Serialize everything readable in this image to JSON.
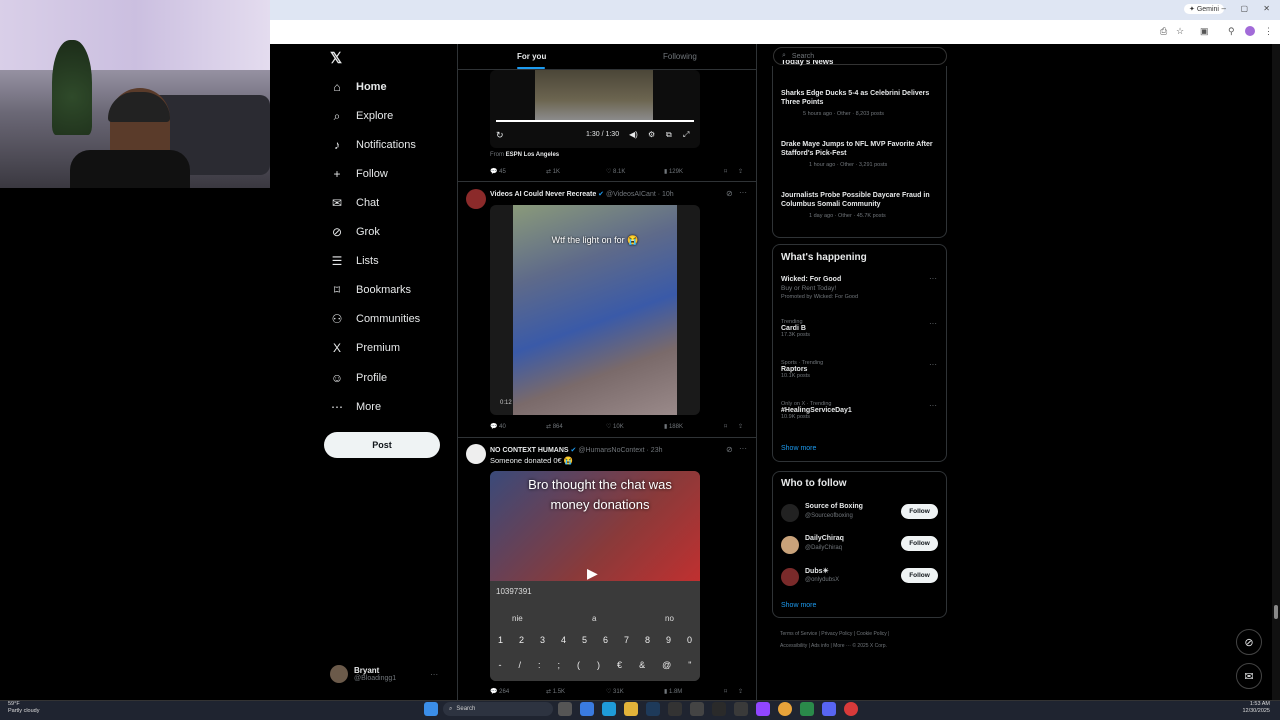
{
  "browser": {
    "gemini_label": "Gemini",
    "window_controls": [
      "–",
      "▢",
      "✕"
    ]
  },
  "nav": {
    "items": [
      {
        "label": "Home",
        "icon": "⌂",
        "icon_name": "home-icon"
      },
      {
        "label": "Explore",
        "icon": "⌕",
        "icon_name": "search-icon"
      },
      {
        "label": "Notifications",
        "icon": "♪",
        "icon_name": "bell-icon"
      },
      {
        "label": "Follow",
        "icon": "+",
        "icon_name": "add-person-icon"
      },
      {
        "label": "Chat",
        "icon": "✉",
        "icon_name": "mail-icon"
      },
      {
        "label": "Grok",
        "icon": "⊘",
        "icon_name": "grok-icon"
      },
      {
        "label": "Lists",
        "icon": "☰",
        "icon_name": "list-icon"
      },
      {
        "label": "Bookmarks",
        "icon": "⌑",
        "icon_name": "bookmark-icon"
      },
      {
        "label": "Communities",
        "icon": "⚇",
        "icon_name": "communities-icon"
      },
      {
        "label": "Premium",
        "icon": "X",
        "icon_name": "x-premium-icon"
      },
      {
        "label": "Profile",
        "icon": "☺",
        "icon_name": "person-icon"
      },
      {
        "label": "More",
        "icon": "⋯",
        "icon_name": "more-circle-icon"
      }
    ],
    "post_label": "Post",
    "profile_name": "Bryant",
    "profile_handle": "@Bloadingg1"
  },
  "feed": {
    "tabs": [
      {
        "label": "For you"
      },
      {
        "label": "Following"
      }
    ],
    "tweet1": {
      "video_time": "1:30 / 1:30",
      "from_label": "From",
      "from_source": "ESPN Los Angeles",
      "replies": "45",
      "reposts": "1K",
      "likes": "8.1K",
      "views": "129K"
    },
    "tweet2": {
      "name": "Videos AI Could Never Recreate",
      "handle": "@VideosAICant · 10h",
      "caption": "Wtf the light on for 😭",
      "video_time": "0:12",
      "replies": "40",
      "reposts": "864",
      "likes": "10K",
      "views": "188K"
    },
    "tweet3": {
      "name": "NO CONTEXT HUMANS",
      "handle": "@HumansNoContext · 23h",
      "text": "Someone donated 0€ 😭",
      "video_caption": "Bro thought the chat was money donations",
      "number_display": "10397391",
      "keypad_labels": [
        "nie",
        "a",
        "no"
      ],
      "keys_row1": [
        "1",
        "2",
        "3",
        "4",
        "5",
        "6",
        "7",
        "8",
        "9",
        "0"
      ],
      "keys_row2": [
        "-",
        "/",
        ":",
        ";",
        "(",
        ")",
        "€",
        "&",
        "@",
        "\""
      ],
      "replies": "264",
      "reposts": "1.5K",
      "likes": "31K",
      "views": "1.8M"
    }
  },
  "right": {
    "search_placeholder": "Search",
    "news_header": "Today's News",
    "news": [
      {
        "title": "Sharks Edge Ducks 5-4 as Celebrini Delivers Three Points",
        "meta": "5 hours ago · Other · 8,203 posts"
      },
      {
        "title": "Drake Maye Jumps to NFL MVP Favorite After Stafford's Pick-Fest",
        "meta": "1 hour ago · Other · 3,291 posts"
      },
      {
        "title": "Journalists Probe Possible Daycare Fraud in Columbus Somali Community",
        "meta": "1 day ago · Other · 45.7K posts"
      }
    ],
    "happening_header": "What's happening",
    "trends": [
      {
        "sub": "",
        "name": "Wicked: For Good",
        "extra": "Buy or Rent Today!",
        "extra2": "Promoted by Wicked: For Good"
      },
      {
        "sub": "Trending",
        "name": "Cardi B",
        "extra": "17.3K posts",
        "extra2": ""
      },
      {
        "sub": "Sports · Trending",
        "name": "Raptors",
        "extra": "10.1K posts",
        "extra2": ""
      },
      {
        "sub": "Only on X · Trending",
        "name": "#HealingServiceDay1",
        "extra": "10.9K posts",
        "extra2": ""
      }
    ],
    "show_more": "Show more",
    "wtf_header": "Who to follow",
    "follow": [
      {
        "name": "Source of Boxing",
        "handle": "@Sourceofboxing",
        "btn": "Follow"
      },
      {
        "name": "DailyChiraq",
        "handle": "@DailyChiraq",
        "btn": "Follow"
      },
      {
        "name": "Dubs☀",
        "handle": "@onlydubsX",
        "btn": "Follow"
      }
    ],
    "footer_line1": "Terms of Service  |  Privacy Policy  |  Cookie Policy  |",
    "footer_line2": "Accessibility  |  Ads info  |  More ···  © 2025 X Corp."
  },
  "taskbar": {
    "weather_temp": "59°F",
    "weather_desc": "Partly cloudy",
    "search_label": "Search",
    "time": "1:53 AM",
    "date": "12/30/2025"
  },
  "colors": {
    "accent": "#1d9bf0",
    "bg": "#000000",
    "border": "#2f3336"
  }
}
